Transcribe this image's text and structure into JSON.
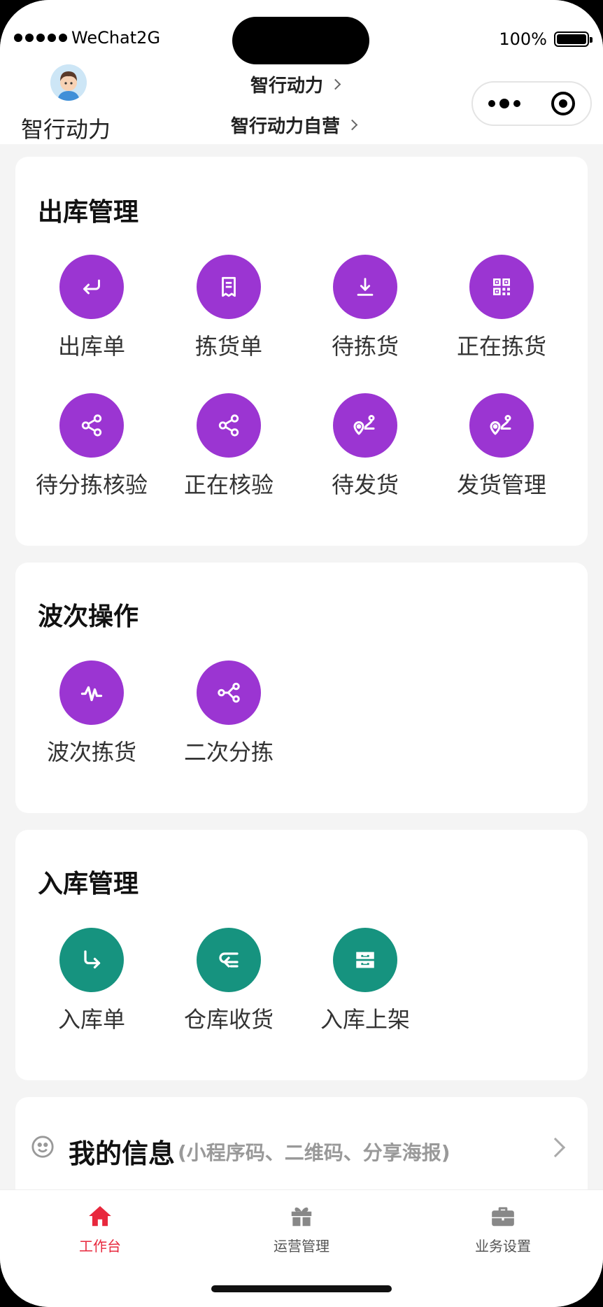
{
  "status_bar": {
    "carrier": "WeChat2G",
    "battery": "100%"
  },
  "header": {
    "org_name": "智行动力",
    "company_switch": "智行动力",
    "warehouse_switch": "智行动力自营"
  },
  "sections": {
    "outbound": {
      "title": "出库管理",
      "items": [
        {
          "label": "出库单",
          "icon": "enter-return-icon"
        },
        {
          "label": "拣货单",
          "icon": "receipt-icon"
        },
        {
          "label": "待拣货",
          "icon": "download-icon"
        },
        {
          "label": "正在拣货",
          "icon": "qr-code-icon"
        },
        {
          "label": "待分拣核验",
          "icon": "share-icon"
        },
        {
          "label": "正在核验",
          "icon": "share-icon"
        },
        {
          "label": "待发货",
          "icon": "route-pin-icon"
        },
        {
          "label": "发货管理",
          "icon": "route-pin-icon"
        }
      ]
    },
    "wave": {
      "title": "波次操作",
      "items": [
        {
          "label": "波次拣货",
          "icon": "wave-icon"
        },
        {
          "label": "二次分拣",
          "icon": "share-alt-icon"
        }
      ]
    },
    "inbound": {
      "title": "入库管理",
      "items": [
        {
          "label": "入库单",
          "icon": "turn-right-arrow-icon"
        },
        {
          "label": "仓库收货",
          "icon": "wrap-text-icon"
        },
        {
          "label": "入库上架",
          "icon": "inbox-icon"
        }
      ]
    }
  },
  "my_info": {
    "title": "我的信息",
    "subtitle": "(小程序码、二维码、分享海报)"
  },
  "tabbar": {
    "items": [
      {
        "label": "工作台",
        "icon": "home-icon",
        "active": true
      },
      {
        "label": "运营管理",
        "icon": "gift-icon",
        "active": false
      },
      {
        "label": "业务设置",
        "icon": "briefcase-icon",
        "active": false
      }
    ]
  },
  "colors": {
    "purple": "#9b35d2",
    "teal": "#16937f",
    "active_tab": "#e8283d"
  }
}
